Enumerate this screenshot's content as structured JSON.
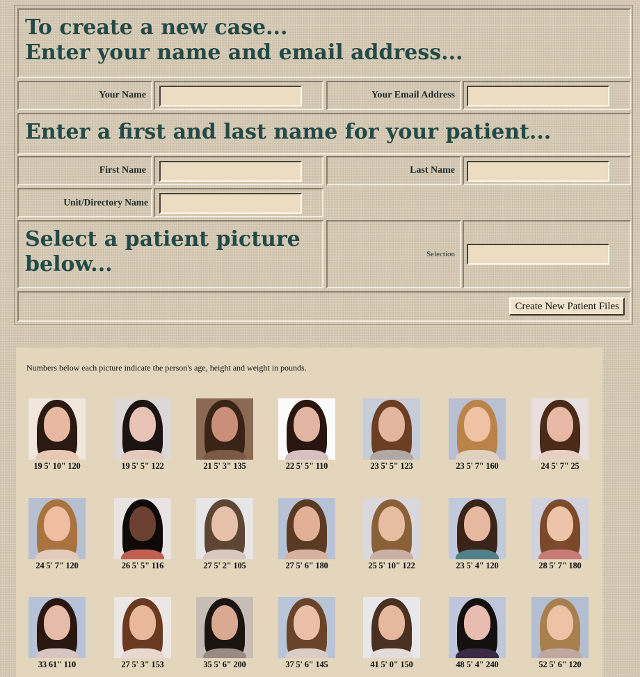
{
  "form": {
    "heading_line1": "To create a new case...",
    "heading_line2": "Enter your name and email address...",
    "your_name_label": "Your Name",
    "your_name_value": "",
    "email_label": "Your Email Address",
    "email_value": "",
    "patient_heading": "Enter a first and last name for your patient...",
    "first_name_label": "First Name",
    "first_name_value": "",
    "last_name_label": "Last Name",
    "last_name_value": "",
    "unit_label": "Unit/Directory Name",
    "unit_value": "",
    "select_heading_line1": "Select a patient picture",
    "select_heading_line2": "below...",
    "selection_label": "Selection",
    "selection_value": "",
    "create_button": "Create New Patient Files"
  },
  "gallery": {
    "note": "Numbers below each picture indicate the person's age, height and weight in pounds.",
    "pictures": [
      {
        "caption": "19 5' 10\" 120",
        "hair": "#2a1a12",
        "skin": "#e8b9a0",
        "bg": "#f0e6dc",
        "shirt": "#e6c8b4"
      },
      {
        "caption": "19 5' 5\" 122",
        "hair": "#1c1410",
        "skin": "#e9c2b6",
        "bg": "#ddd8d6",
        "shirt": "#e4c9bd"
      },
      {
        "caption": "21 5' 3\" 135",
        "hair": "#3a2416",
        "skin": "#c98f78",
        "bg": "#8a6a52",
        "shirt": "#7a5a44"
      },
      {
        "caption": "22 5' 5\" 110",
        "hair": "#2a1610",
        "skin": "#e2b4a2",
        "bg": "#fbfbfb",
        "shirt": "#d9c0c0"
      },
      {
        "caption": "23 5' 5\" 123",
        "hair": "#6b3f24",
        "skin": "#e3b69d",
        "bg": "#c6cdd8",
        "shirt": "#b0a8a4"
      },
      {
        "caption": "23 5' 7\" 160",
        "hair": "#b9834a",
        "skin": "#efc2a4",
        "bg": "#b8c0d2",
        "shirt": "#e0d0c0"
      },
      {
        "caption": "24 5' 7\" 25",
        "hair": "#4a2a18",
        "skin": "#e8b9a6",
        "bg": "#e8dede",
        "shirt": "#e6cfc4"
      },
      {
        "caption": "24 5' 7\" 120",
        "hair": "#a8733e",
        "skin": "#eebda2",
        "bg": "#b6c0d0",
        "shirt": "#e2cbbd"
      },
      {
        "caption": "26 5' 5\" 116",
        "hair": "#0e0a08",
        "skin": "#6b4030",
        "bg": "#e9e4e2",
        "shirt": "#c06050"
      },
      {
        "caption": "27 5' 2\" 105",
        "hair": "#5e4634",
        "skin": "#e7c0ac",
        "bg": "#e7e5e6",
        "shirt": "#d8c8c0"
      },
      {
        "caption": "27 5' 6\" 180",
        "hair": "#5a3a22",
        "skin": "#e2b096",
        "bg": "#b8c2d6",
        "shirt": "#d8b0a0"
      },
      {
        "caption": "25 5' 10\" 122",
        "hair": "#8a6038",
        "skin": "#e7bda2",
        "bg": "#dad8dc",
        "shirt": "#c8b0a4"
      },
      {
        "caption": "23 5' 4\" 120",
        "hair": "#3a2418",
        "skin": "#e6b8a0",
        "bg": "#c0cad8",
        "shirt": "#50808a"
      },
      {
        "caption": "28 5' 7\" 180",
        "hair": "#7a4a2a",
        "skin": "#eec4a8",
        "bg": "#d0d2de",
        "shirt": "#c87a78"
      },
      {
        "caption": "33 61\" 110",
        "hair": "#2a1810",
        "skin": "#e6bca8",
        "bg": "#b6c2d8",
        "shirt": "#d8c4c0"
      },
      {
        "caption": "27 5' 3\" 153",
        "hair": "#6a3a20",
        "skin": "#e9b89c",
        "bg": "#ece6e4",
        "shirt": "#e8d8d0"
      },
      {
        "caption": "35 5' 6\" 200",
        "hair": "#1c1410",
        "skin": "#d8a890",
        "bg": "#c8bcb6",
        "shirt": "#9a8a84"
      },
      {
        "caption": "37 5' 6\" 145",
        "hair": "#6a4428",
        "skin": "#ecbfa8",
        "bg": "#b8c4d8",
        "shirt": "#dcccc8"
      },
      {
        "caption": "41 5' 0\" 150",
        "hair": "#4a3020",
        "skin": "#e6b89e",
        "bg": "#e8e8ea",
        "shirt": "#e4dcd8"
      },
      {
        "caption": "48 5' 4\" 240",
        "hair": "#141010",
        "skin": "#e8bcb0",
        "bg": "#c0c6da",
        "shirt": "#3a2a44"
      },
      {
        "caption": "52 5' 6\" 120",
        "hair": "#a8804e",
        "skin": "#edc2a6",
        "bg": "#b4bed2",
        "shirt": "#c0a8a0"
      }
    ]
  }
}
